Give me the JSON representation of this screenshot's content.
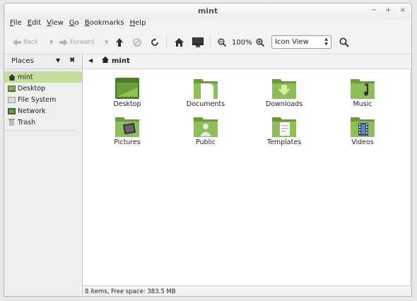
{
  "window": {
    "title": "mint",
    "controls": [
      "−",
      "+",
      "×"
    ]
  },
  "menu": [
    "File",
    "Edit",
    "View",
    "Go",
    "Bookmarks",
    "Help"
  ],
  "toolbar": {
    "back_label": "Back",
    "forward_label": "Forward",
    "zoom_level": "100%",
    "view_mode": "Icon View"
  },
  "sidebar": {
    "title": "Places",
    "items": [
      {
        "label": "mint",
        "icon": "home-icon",
        "selected": true
      },
      {
        "label": "Desktop",
        "icon": "desktop-icon"
      },
      {
        "label": "File System",
        "icon": "harddisk-icon"
      },
      {
        "label": "Network",
        "icon": "network-icon"
      },
      {
        "label": "Trash",
        "icon": "trash-icon"
      }
    ]
  },
  "location": {
    "crumb": "mint"
  },
  "files": [
    {
      "name": "Desktop",
      "icon": "desktop-folder-icon"
    },
    {
      "name": "Documents",
      "icon": "documents-folder-icon"
    },
    {
      "name": "Downloads",
      "icon": "downloads-folder-icon"
    },
    {
      "name": "Music",
      "icon": "music-folder-icon"
    },
    {
      "name": "Pictures",
      "icon": "pictures-folder-icon"
    },
    {
      "name": "Public",
      "icon": "public-folder-icon"
    },
    {
      "name": "Templates",
      "icon": "templates-folder-icon"
    },
    {
      "name": "Videos",
      "icon": "videos-folder-icon"
    }
  ],
  "status": "8 items, Free space: 383.5 MB",
  "colors": {
    "folder_green": "#6c9a3b",
    "folder_light": "#bcd99a",
    "selection": "#c7dd9f"
  }
}
